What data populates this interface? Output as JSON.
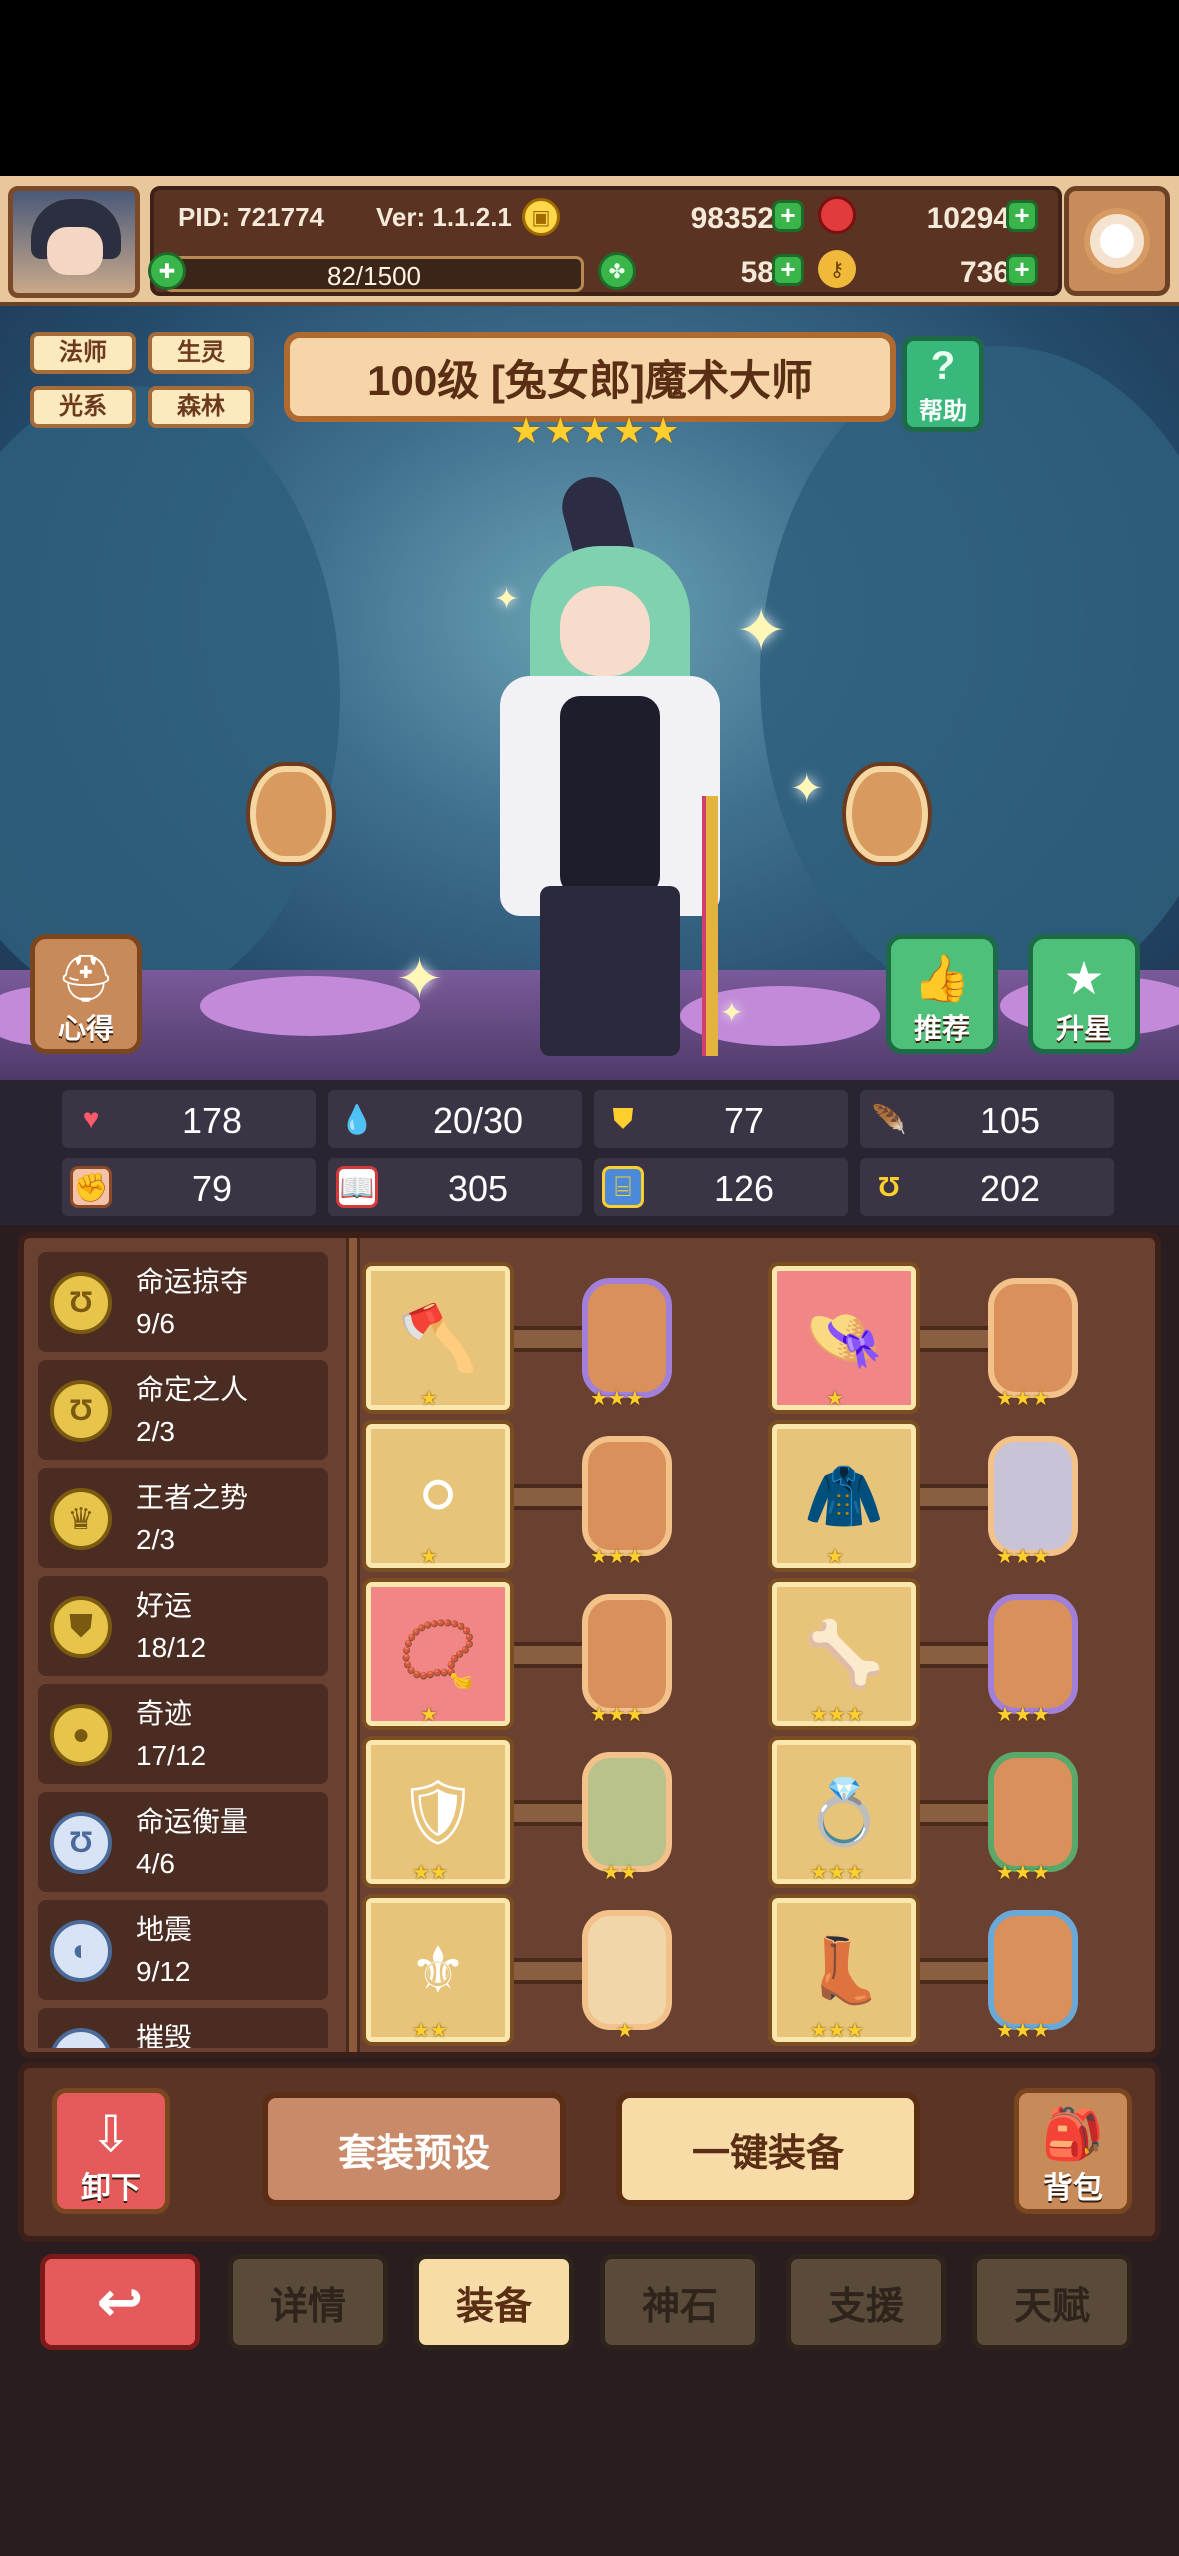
{
  "header": {
    "pid": "PID: 721774",
    "version": "Ver: 1.1.2.1",
    "gold": "98352",
    "ruby": "10294",
    "clover": "58",
    "key_count": "736",
    "exp": "82/1500"
  },
  "tags": [
    "法师",
    "生灵",
    "光系",
    "森林"
  ],
  "title": "100级 [兔女郎]魔术大师",
  "star_count": 5,
  "help_label": "帮助",
  "side_buttons": {
    "notes": "心得",
    "recommend": "推荐",
    "star_up": "升星"
  },
  "stats": [
    {
      "icon": "heart-icon",
      "value": "178"
    },
    {
      "icon": "water-drop-icon",
      "value": "20/30"
    },
    {
      "icon": "shield-icon",
      "value": "77"
    },
    {
      "icon": "wing-icon",
      "value": "105"
    },
    {
      "icon": "fist-icon",
      "value": "79"
    },
    {
      "icon": "book-icon",
      "value": "305"
    },
    {
      "icon": "stairs-icon",
      "value": "126"
    },
    {
      "icon": "horseshoe-icon",
      "value": "202"
    }
  ],
  "sets": [
    {
      "name": "命运掠夺",
      "count": "9/6"
    },
    {
      "name": "命定之人",
      "count": "2/3"
    },
    {
      "name": "王者之势",
      "count": "2/3"
    },
    {
      "name": "好运",
      "count": "18/12"
    },
    {
      "name": "奇迹",
      "count": "17/12"
    },
    {
      "name": "命运衡量",
      "count": "4/6"
    },
    {
      "name": "地震",
      "count": "9/12"
    },
    {
      "name": "摧毁",
      "count": ""
    }
  ],
  "equipment": [
    {
      "item": "axe-icon",
      "item_stars": "★",
      "gem": "purple",
      "gem_stars": "★★★"
    },
    {
      "item": "straw-hat-icon",
      "item_stars": "★",
      "gem": "orange",
      "gem_stars": "★★★"
    },
    {
      "item": "orb-icon",
      "item_stars": "★",
      "gem": "orange",
      "gem_stars": "★★★"
    },
    {
      "item": "cloak-icon",
      "item_stars": "★",
      "gem": "silver",
      "gem_stars": "★★★"
    },
    {
      "item": "necklace-icon",
      "item_stars": "★",
      "gem": "orange",
      "gem_stars": "★★★"
    },
    {
      "item": "bracer-icon",
      "item_stars": "★★★",
      "gem": "purple",
      "gem_stars": "★★★"
    },
    {
      "item": "armor-icon",
      "item_stars": "★★",
      "gem": "pale",
      "gem_stars": "★★"
    },
    {
      "item": "ring-icon",
      "item_stars": "★★★",
      "gem": "green",
      "gem_stars": "★★★"
    },
    {
      "item": "belt-icon",
      "item_stars": "★★",
      "gem": "orange",
      "gem_stars": "★"
    },
    {
      "item": "boots-icon",
      "item_stars": "★★★",
      "gem": "blue",
      "gem_stars": "★★★"
    }
  ],
  "actions": {
    "unequip": "卸下",
    "preset": "套装预设",
    "equip_all": "一键装备",
    "bag": "背包"
  },
  "nav": {
    "back": "↩",
    "tabs": [
      "详情",
      "装备",
      "神石",
      "支援",
      "天赋"
    ],
    "active": "装备"
  },
  "colors": {
    "gold": "#ffcf2e",
    "panel": "#6a4030",
    "plus": "#39b54a",
    "danger": "#e55a5a"
  }
}
